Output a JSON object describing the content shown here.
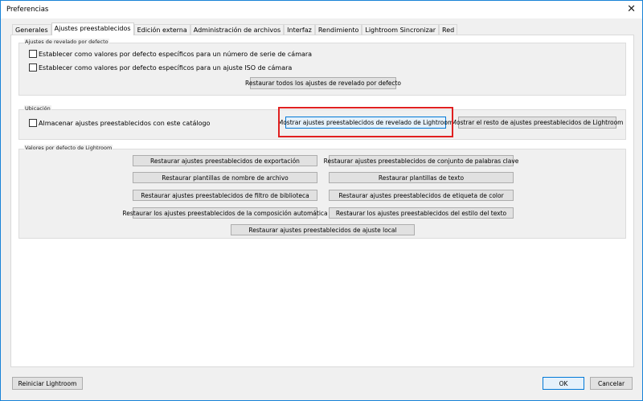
{
  "window": {
    "title": "Preferencias",
    "close_icon": "close-icon"
  },
  "tabs": [
    {
      "label": "Generales"
    },
    {
      "label": "Ajustes preestablecidos",
      "active": true
    },
    {
      "label": "Edición externa"
    },
    {
      "label": "Administración de archivos"
    },
    {
      "label": "Interfaz"
    },
    {
      "label": "Rendimiento"
    },
    {
      "label": "Lightroom Sincronizar"
    },
    {
      "label": "Red"
    }
  ],
  "develop_defaults": {
    "title": "Ajustes de revelado por defecto",
    "checkbox_serial": "Establecer como valores por defecto específicos para un número de serie de cámara",
    "checkbox_iso": "Establecer como valores por defecto específicos para un ajuste ISO de cámara",
    "restore_all": "Restaurar todos los ajustes de revelado por defecto"
  },
  "location": {
    "title": "Ubicación",
    "checkbox_store": "Almacenar ajustes preestablecidos con este catálogo",
    "show_develop": "Mostrar ajustes preestablecidos de revelado de Lightroom",
    "show_other": "Mostrar el resto de ajustes preestablecidos de Lightroom"
  },
  "lightroom_defaults": {
    "title": "Valores por defecto de Lightroom",
    "buttons": [
      "Restaurar ajustes preestablecidos de exportación",
      "Restaurar ajustes preestablecidos de conjunto de palabras clave",
      "Restaurar plantillas de nombre de archivo",
      "Restaurar plantillas de texto",
      "Restaurar ajustes preestablecidos de filtro de biblioteca",
      "Restaurar ajustes preestablecidos de etiqueta de color",
      "Restaurar los ajustes preestablecidos de la composición automática",
      "Restaurar los ajustes preestablecidos del estilo del texto",
      "Restaurar ajustes preestablecidos de ajuste local"
    ]
  },
  "footer": {
    "restart": "Reiniciar Lightroom",
    "ok": "OK",
    "cancel": "Cancelar"
  }
}
